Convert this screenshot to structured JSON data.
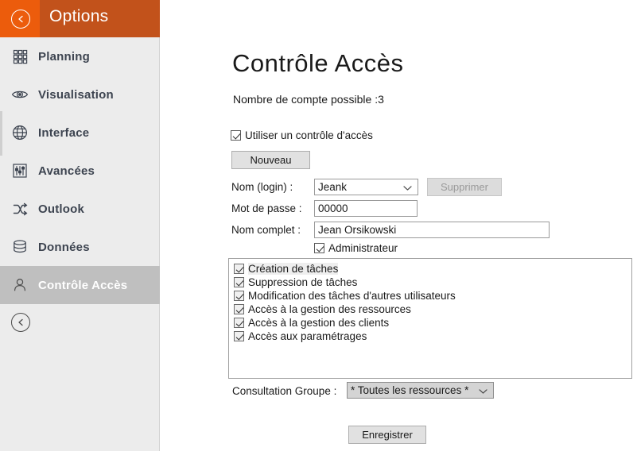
{
  "sidebar": {
    "header": {
      "title": "Options",
      "back_icon": "circle-back-arrow-icon",
      "bg_color": "#c2521b",
      "back_cell_color": "#ec5c0c"
    },
    "items": [
      {
        "label": "Planning",
        "icon": "grid-icon",
        "selected": false
      },
      {
        "label": "Visualisation",
        "icon": "eye-icon",
        "selected": false
      },
      {
        "label": "Interface",
        "icon": "globe-icon",
        "selected": false
      },
      {
        "label": "Avancées",
        "icon": "sliders-icon",
        "selected": false
      },
      {
        "label": "Outlook",
        "icon": "shuffle-icon",
        "selected": false
      },
      {
        "label": "Données",
        "icon": "database-icon",
        "selected": false
      },
      {
        "label": "Contrôle Accès",
        "icon": "person-icon",
        "selected": true
      }
    ],
    "bottom_back_icon": "circle-back-arrow-icon",
    "bg_color": "#ececec",
    "selected_bg_color": "#bfbfbf"
  },
  "main": {
    "title": "Contrôle Accès",
    "account_count_text": "Nombre de compte possible :3",
    "use_access_control": {
      "label": "Utiliser un contrôle d'accès",
      "checked": true
    },
    "buttons": {
      "new": "Nouveau",
      "delete": "Supprimer",
      "save": "Enregistrer"
    },
    "fields": {
      "login_label": "Nom (login) :",
      "login_value": "Jeank",
      "password_label": "Mot de passe :",
      "password_value": "00000",
      "fullname_label": "Nom complet :",
      "fullname_value": "Jean Orsikowski",
      "admin_label": "Administrateur",
      "admin_checked": true
    },
    "permissions": [
      {
        "label": "Création de tâches",
        "checked": true
      },
      {
        "label": "Suppression de tâches",
        "checked": true
      },
      {
        "label": "Modification des tâches d'autres utilisateurs",
        "checked": true
      },
      {
        "label": "Accès à la gestion des ressources",
        "checked": true
      },
      {
        "label": "Accès à la gestion des clients",
        "checked": true
      },
      {
        "label": "Accès aux paramétrages",
        "checked": true
      }
    ],
    "group": {
      "label": "Consultation Groupe :",
      "value": "* Toutes les ressources *"
    }
  }
}
